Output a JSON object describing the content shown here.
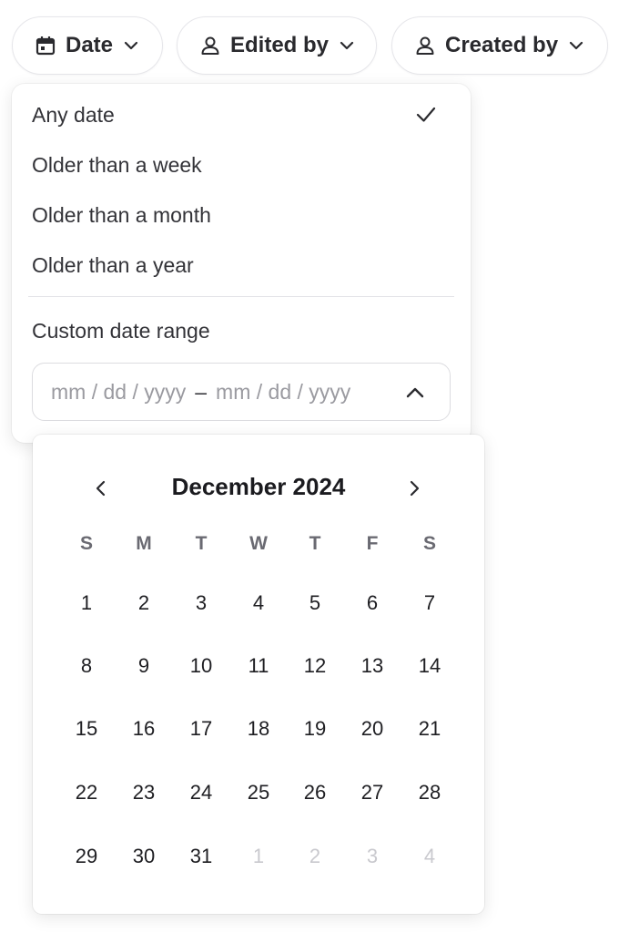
{
  "filters": {
    "date_label": "Date",
    "edited_label": "Edited by",
    "created_label": "Created by"
  },
  "date_menu": {
    "options": [
      {
        "label": "Any date",
        "selected": true
      },
      {
        "label": "Older than a week",
        "selected": false
      },
      {
        "label": "Older than a month",
        "selected": false
      },
      {
        "label": "Older than a year",
        "selected": false
      }
    ],
    "custom_label": "Custom date range",
    "range": {
      "start_placeholder": "mm / dd / yyyy",
      "separator": "–",
      "end_placeholder": "mm / dd / yyyy"
    }
  },
  "calendar": {
    "month_title": "December 2024",
    "weekdays": [
      "S",
      "M",
      "T",
      "W",
      "T",
      "F",
      "S"
    ],
    "weeks": [
      [
        {
          "d": "1"
        },
        {
          "d": "2"
        },
        {
          "d": "3"
        },
        {
          "d": "4"
        },
        {
          "d": "5"
        },
        {
          "d": "6"
        },
        {
          "d": "7"
        }
      ],
      [
        {
          "d": "8"
        },
        {
          "d": "9"
        },
        {
          "d": "10"
        },
        {
          "d": "11"
        },
        {
          "d": "12"
        },
        {
          "d": "13"
        },
        {
          "d": "14"
        }
      ],
      [
        {
          "d": "15"
        },
        {
          "d": "16"
        },
        {
          "d": "17"
        },
        {
          "d": "18"
        },
        {
          "d": "19"
        },
        {
          "d": "20"
        },
        {
          "d": "21"
        }
      ],
      [
        {
          "d": "22"
        },
        {
          "d": "23"
        },
        {
          "d": "24"
        },
        {
          "d": "25"
        },
        {
          "d": "26"
        },
        {
          "d": "27"
        },
        {
          "d": "28"
        }
      ],
      [
        {
          "d": "29"
        },
        {
          "d": "30"
        },
        {
          "d": "31"
        },
        {
          "d": "1",
          "outside": true
        },
        {
          "d": "2",
          "outside": true
        },
        {
          "d": "3",
          "outside": true
        },
        {
          "d": "4",
          "outside": true
        }
      ]
    ]
  },
  "icons": {
    "date": "calendar-icon",
    "edited": "person-icon",
    "created": "person-icon",
    "dropdown": "chevron-down-icon",
    "selected": "checkmark-icon",
    "collapse": "chevron-up-icon",
    "prev": "chevron-left-icon",
    "next": "chevron-right-icon"
  },
  "colors": {
    "text": "#222226",
    "muted_day": "#c9c9ce",
    "placeholder": "#9a9aa0",
    "border": "#e6e6ea"
  }
}
